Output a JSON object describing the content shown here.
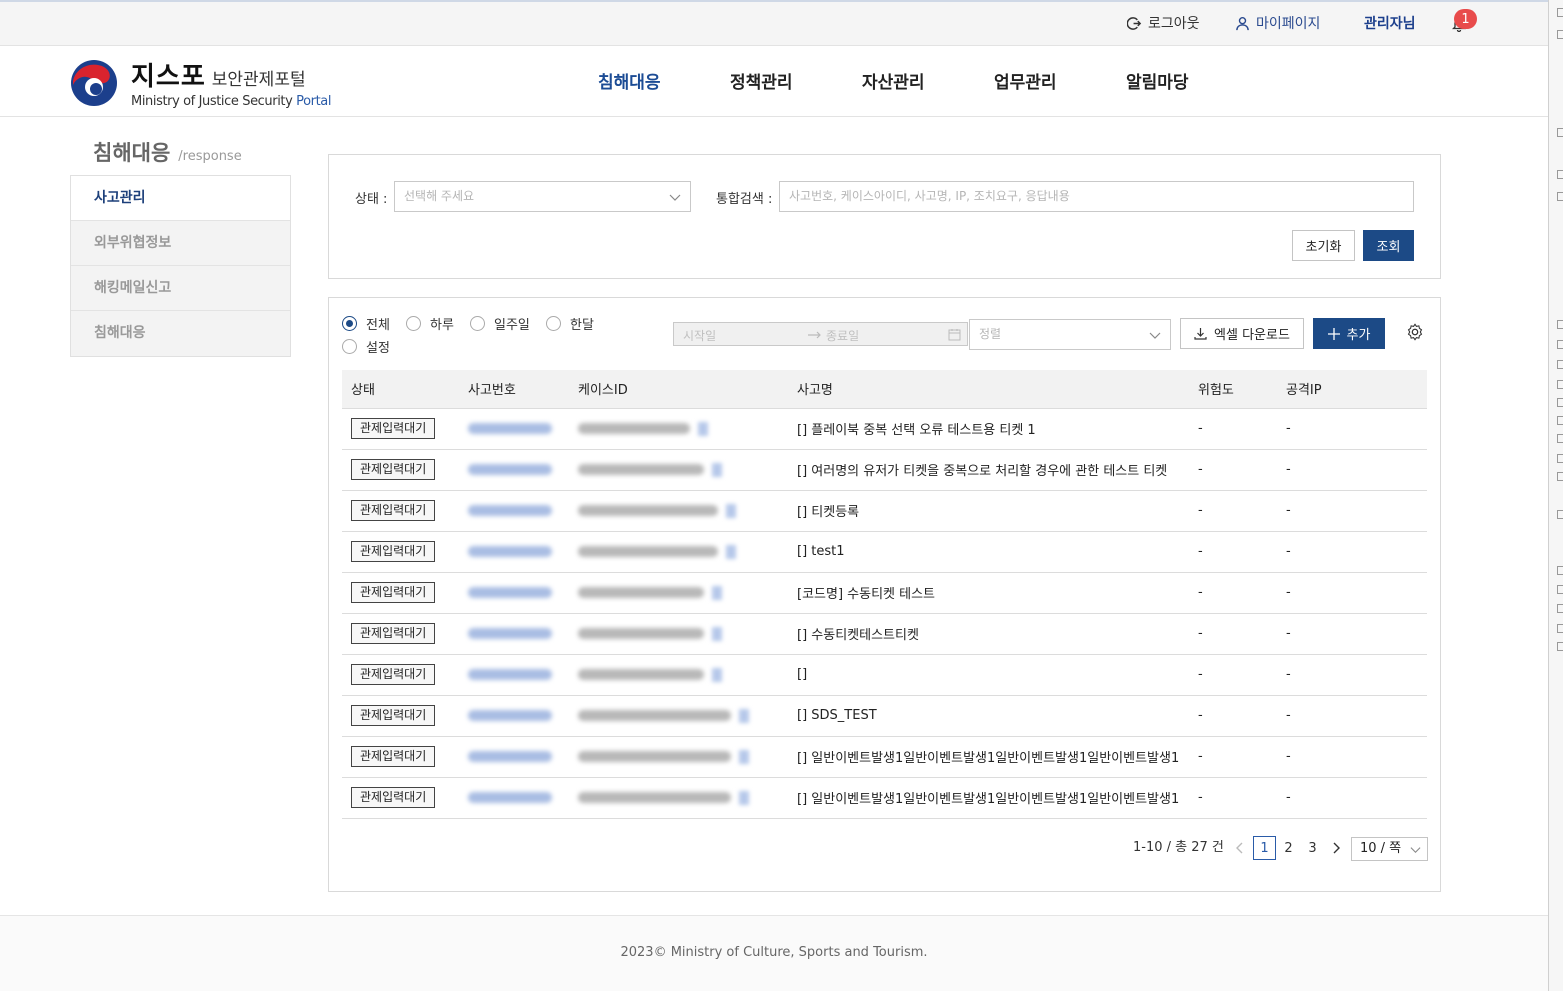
{
  "topbar": {
    "logout": "로그아웃",
    "mypage": "마이페이지",
    "admin": "관리자님",
    "notification_count": "1"
  },
  "header": {
    "brand_main": "지스포",
    "brand_sub": "보안관제포털",
    "brand_en_prefix": "Ministry of Justice Security ",
    "brand_en_suffix": "Portal",
    "nav": [
      "침해대응",
      "정책관리",
      "자산관리",
      "업무관리",
      "알림마당"
    ]
  },
  "sidebar": {
    "title": "침해대응",
    "title_en": "/response",
    "items": [
      "사고관리",
      "외부위협정보",
      "해킹메일신고",
      "침해대응"
    ]
  },
  "search": {
    "status_label": "상태 :",
    "status_placeholder": "선택해 주세요",
    "keyword_label": "통합검색 :",
    "keyword_placeholder": "사고번호, 케이스아이디, 사고명, IP, 조치요구, 응답내용",
    "reset_label": "초기화",
    "search_label": "조회"
  },
  "filters": {
    "periods": [
      "전체",
      "하루",
      "일주일",
      "한달",
      "설정"
    ],
    "selected_period": "전체",
    "start_placeholder": "시작일",
    "end_placeholder": "종료일",
    "sort_placeholder": "정렬",
    "excel_label": "엑셀 다운로드",
    "add_label": "추가"
  },
  "table": {
    "columns": [
      "상태",
      "사고번호",
      "케이스ID",
      "사고명",
      "위험도",
      "공격IP"
    ],
    "rows": [
      {
        "status": "관제입력대기",
        "name": "[] 플레이북 중복 선택 오류 테스트용 티켓 1",
        "risk": "-",
        "ip": "-"
      },
      {
        "status": "관제입력대기",
        "name": "[] 여러명의 유저가 티켓을 중복으로 처리할 경우에 관한 테스트 티켓",
        "risk": "-",
        "ip": "-"
      },
      {
        "status": "관제입력대기",
        "name": "[] 티켓등록",
        "risk": "-",
        "ip": "-"
      },
      {
        "status": "관제입력대기",
        "name": "[] test1",
        "risk": "-",
        "ip": "-"
      },
      {
        "status": "관제입력대기",
        "name": "[코드명] 수동티켓 테스트",
        "risk": "-",
        "ip": "-"
      },
      {
        "status": "관제입력대기",
        "name": "[] 수동티켓테스트티켓",
        "risk": "-",
        "ip": "-"
      },
      {
        "status": "관제입력대기",
        "name": "[]",
        "risk": "-",
        "ip": "-"
      },
      {
        "status": "관제입력대기",
        "name": "[] SDS_TEST",
        "risk": "-",
        "ip": "-"
      },
      {
        "status": "관제입력대기",
        "name": "[] 일반이벤트발생1일반이벤트발생1일반이벤트발생1일반이벤트발생1",
        "risk": "-",
        "ip": "-"
      },
      {
        "status": "관제입력대기",
        "name": "[] 일반이벤트발생1일반이벤트발생1일반이벤트발생1일반이벤트발생1",
        "risk": "-",
        "ip": "-"
      }
    ]
  },
  "pagination": {
    "summary": "1-10 / 총 27 건",
    "pages": [
      "1",
      "2",
      "3"
    ],
    "current": "1",
    "page_size": "10 / 쪽"
  },
  "footer": {
    "copyright": "2023© Ministry of Culture, Sports and Tourism."
  },
  "colors": {
    "accent": "#1c4a86",
    "badge": "#e84b4b"
  }
}
